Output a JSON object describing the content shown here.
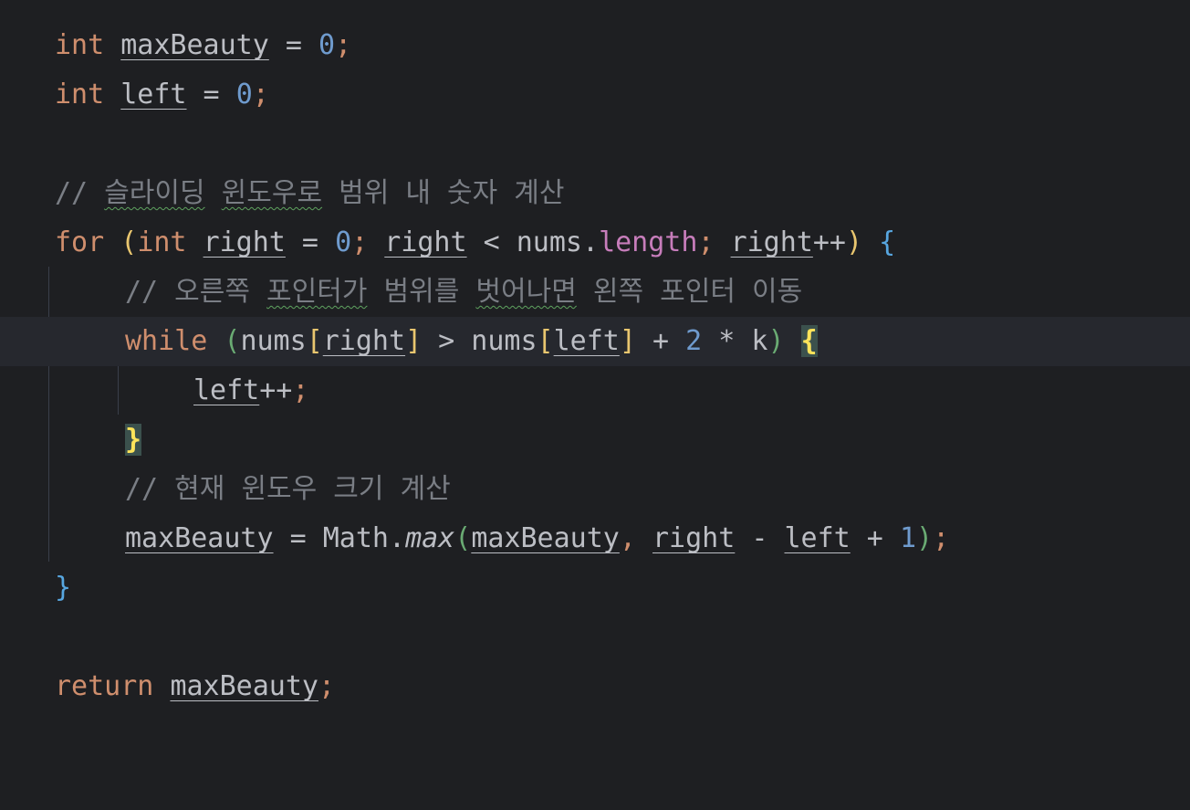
{
  "colors": {
    "background": "#1e1f22",
    "keyword": "#cf8e6d",
    "number": "#6f9bce",
    "comment": "#7a7e85",
    "field": "#c77dbb",
    "brace_match": "#fce35a"
  },
  "code": {
    "line1": {
      "kw": "int",
      "var": "maxBeauty",
      "op": " = ",
      "num": "0",
      "semi": ";"
    },
    "line2": {
      "kw": "int",
      "var": "left",
      "op": " = ",
      "num": "0",
      "semi": ";"
    },
    "line4": {
      "prefix": "// ",
      "w1": "슬라이딩",
      "w2": "윈도우로",
      "rest": " 범위 내 숫자 계산"
    },
    "line5": {
      "kw_for": "for",
      "open": " (",
      "kw_int": "int",
      "sp": " ",
      "right1": "right",
      "eq": " = ",
      "zero": "0",
      "semi1": "; ",
      "right2": "right",
      "lt": " < nums.",
      "length": "length",
      "semi2": "; ",
      "right3": "right",
      "inc": "++",
      "close": ")",
      "sp2": " ",
      "brace": "{"
    },
    "line6": {
      "prefix": "// 오른쪽 ",
      "w1": "포인터가",
      "mid": " 범위를 ",
      "w2": "벗어나면",
      "rest": " 왼쪽 포인터 이동"
    },
    "line7": {
      "kw_while": "while",
      "sp": " ",
      "open": "(",
      "nums1": "nums",
      "b1": "[",
      "right": "right",
      "b2": "]",
      "gt": " > nums",
      "b3": "[",
      "left": "left",
      "b4": "]",
      "plus": " + ",
      "two": "2",
      "times": " * k",
      "close": ")",
      "sp2": " ",
      "brace": "{"
    },
    "line8": {
      "left": "left",
      "inc": "++",
      "semi": ";"
    },
    "line9": {
      "brace": "}"
    },
    "line10": {
      "text": "// 현재 윈도우 크기 계산"
    },
    "line11": {
      "var": "maxBeauty",
      "eq": " = Math.",
      "max": "max",
      "open": "(",
      "arg1": "maxBeauty",
      "comma": ", ",
      "right": "right",
      "minus": " - ",
      "left": "left",
      "plus": " + ",
      "one": "1",
      "close": ")",
      "semi": ";"
    },
    "line12": {
      "brace": "}"
    },
    "line14": {
      "kw": "return",
      "sp": " ",
      "var": "maxBeauty",
      "semi": ";"
    }
  }
}
